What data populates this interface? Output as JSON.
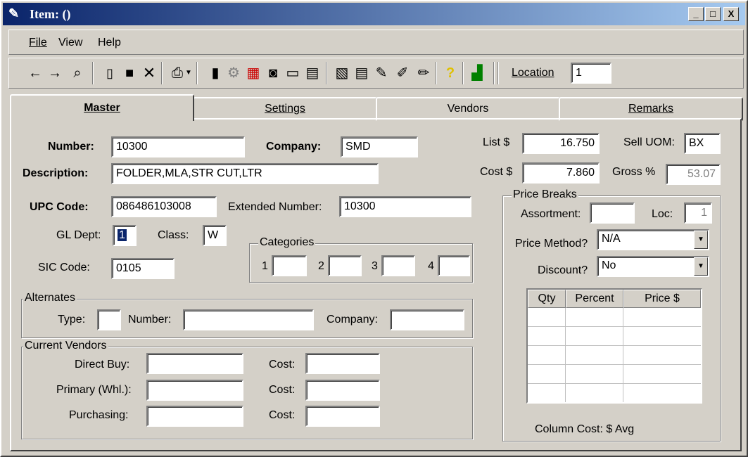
{
  "window": {
    "title": "Item:  ()",
    "minimize": "_",
    "maximize": "□",
    "close": "X"
  },
  "menu": [
    "File",
    "View",
    "Help"
  ],
  "toolbar": {
    "location_label": "Location",
    "location_value": "1"
  },
  "tabs": [
    "Master",
    "Settings",
    "Vendors",
    "Remarks"
  ],
  "master": {
    "number_label": "Number:",
    "number": "10300",
    "company_label": "Company:",
    "company": "SMD",
    "description_label": "Description:",
    "description": "FOLDER,MLA,STR CUT,LTR",
    "upc_label": "UPC Code:",
    "upc": "086486103008",
    "ext_label": "Extended Number:",
    "ext": "10300",
    "gl_label": "GL Dept:",
    "gl": "1",
    "class_label": "Class:",
    "class": "W",
    "sic_label": "SIC Code:",
    "sic": "0105",
    "categories_title": "Categories",
    "cat_labels": [
      "1",
      "2",
      "3",
      "4"
    ],
    "list_label": "List $",
    "list": "16.750",
    "cost_label": "Cost $",
    "cost": "7.860",
    "sell_uom_label": "Sell UOM:",
    "sell_uom": "BX",
    "gross_label": "Gross %",
    "gross": "53.07"
  },
  "alternates": {
    "title": "Alternates",
    "type_label": "Type:",
    "number_label": "Number:",
    "company_label": "Company:"
  },
  "vendors": {
    "title": "Current Vendors",
    "direct_label": "Direct Buy:",
    "primary_label": "Primary (Whl.):",
    "purchasing_label": "Purchasing:",
    "cost_label": "Cost:"
  },
  "price_breaks": {
    "title": "Price Breaks",
    "assortment_label": "Assortment:",
    "loc_label": "Loc:",
    "loc": "1",
    "method_label": "Price Method?",
    "method": "N/A",
    "discount_label": "Discount?",
    "discount": "No",
    "columns": [
      "Qty",
      "Percent",
      "Price $"
    ],
    "footer": "Column Cost: $ Avg"
  }
}
